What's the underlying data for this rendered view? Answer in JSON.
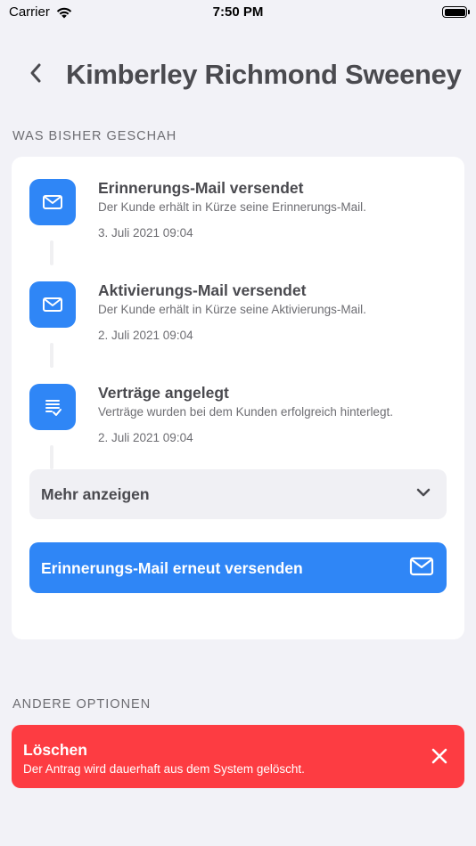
{
  "status_bar": {
    "carrier": "Carrier",
    "time": "7:50 PM"
  },
  "header": {
    "title": "Kimberley Richmond Sweeney"
  },
  "history": {
    "section_label": "WAS BISHER GESCHAH",
    "events": [
      {
        "icon": "mail-icon",
        "title": "Erinnerungs-Mail versendet",
        "description": "Der Kunde erhält in Kürze seine Erinnerungs-Mail.",
        "date": "3. Juli 2021 09:04"
      },
      {
        "icon": "mail-icon",
        "title": "Aktivierungs-Mail versendet",
        "description": "Der Kunde erhält in Kürze seine Aktivierungs-Mail.",
        "date": "2. Juli 2021 09:04"
      },
      {
        "icon": "contract-icon",
        "title": "Verträge angelegt",
        "description": "Verträge wurden bei dem Kunden erfolgreich hinterlegt.",
        "date": "2. Juli 2021 09:04"
      }
    ],
    "more_label": "Mehr anzeigen",
    "resend_label": "Erinnerungs-Mail erneut versenden"
  },
  "other_options": {
    "section_label": "ANDERE OPTIONEN",
    "delete_title": "Löschen",
    "delete_description": "Der Antrag wird dauerhaft aus dem System gelöscht."
  },
  "colors": {
    "accent": "#2f86f6",
    "danger": "#fd3c42",
    "background": "#f2f2f7"
  }
}
